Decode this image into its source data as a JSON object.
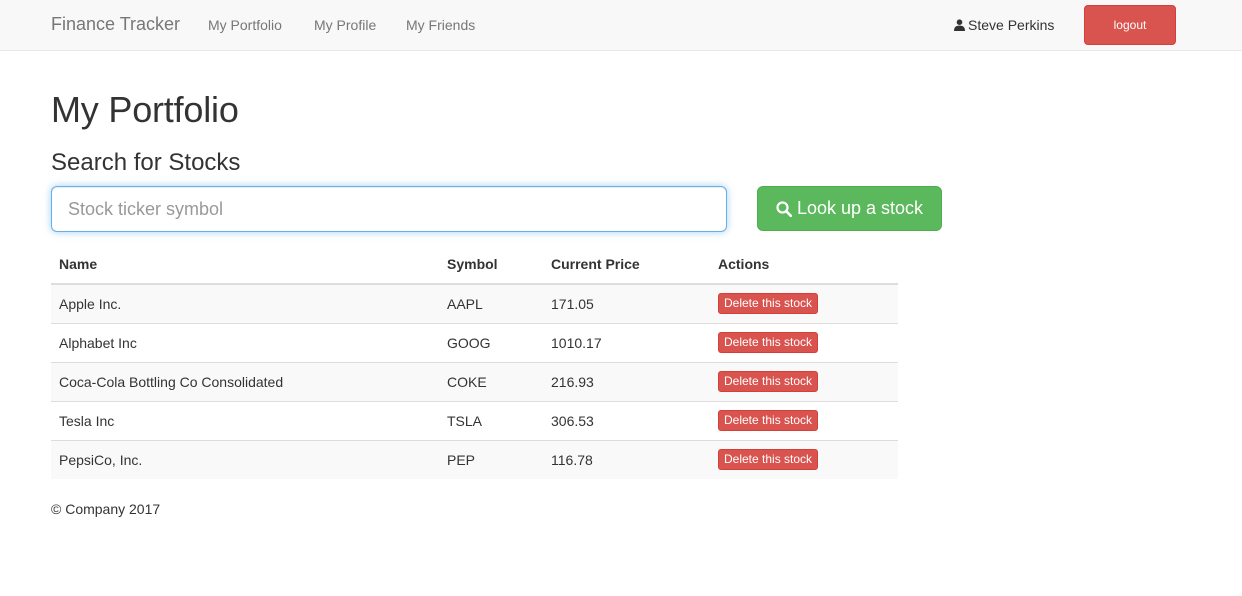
{
  "navbar": {
    "brand": "Finance Tracker",
    "links": [
      "My Portfolio",
      "My Profile",
      "My Friends"
    ],
    "user_name": "Steve Perkins",
    "logout_label": "logout"
  },
  "page": {
    "title": "My Portfolio",
    "subtitle": "Search for Stocks"
  },
  "search": {
    "placeholder": "Stock ticker symbol",
    "value": "",
    "button_label": "Look up a stock"
  },
  "table": {
    "headers": [
      "Name",
      "Symbol",
      "Current Price",
      "Actions"
    ],
    "rows": [
      {
        "name": "Apple Inc.",
        "symbol": "AAPL",
        "price": "171.05",
        "action": "Delete this stock"
      },
      {
        "name": "Alphabet Inc",
        "symbol": "GOOG",
        "price": "1010.17",
        "action": "Delete this stock"
      },
      {
        "name": "Coca-Cola Bottling Co Consolidated",
        "symbol": "COKE",
        "price": "216.93",
        "action": "Delete this stock"
      },
      {
        "name": "Tesla Inc",
        "symbol": "TSLA",
        "price": "306.53",
        "action": "Delete this stock"
      },
      {
        "name": "PepsiCo, Inc.",
        "symbol": "PEP",
        "price": "116.78",
        "action": "Delete this stock"
      }
    ]
  },
  "footer": "© Company 2017",
  "icons": {
    "user": "user-icon",
    "search": "search-icon"
  },
  "colors": {
    "danger": "#d9534f",
    "success": "#5cb85c",
    "navbar_bg": "#f8f8f8"
  }
}
